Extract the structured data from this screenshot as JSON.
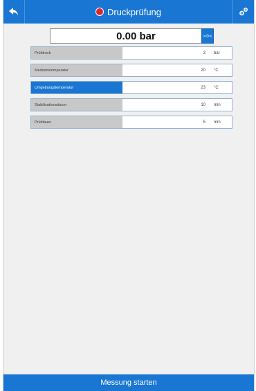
{
  "header": {
    "title": "Druckprüfung",
    "back_icon": "back-arrow-icon",
    "settings_icon": "settings-icon",
    "record_color": "#e0252f"
  },
  "pressure": {
    "value": "0.00 bar",
    "zero_label": ">0<"
  },
  "params": [
    {
      "label": "Prüfdruck",
      "value": "3",
      "unit": "bar",
      "active": false
    },
    {
      "label": "Mediumstemperatur",
      "value": "20",
      "unit": "°C",
      "active": false
    },
    {
      "label": "Umgebungstemperatur",
      "value": "23",
      "unit": "°C",
      "active": true
    },
    {
      "label": "Stabilisationsdauer",
      "value": "10",
      "unit": "min",
      "active": false
    },
    {
      "label": "Prüfdauer",
      "value": "5",
      "unit": "min",
      "active": false
    }
  ],
  "footer": {
    "start_label": "Messung starten"
  },
  "colors": {
    "accent": "#1976d2",
    "background": "#f0f0f0",
    "label_bg": "#c8c8c8"
  }
}
